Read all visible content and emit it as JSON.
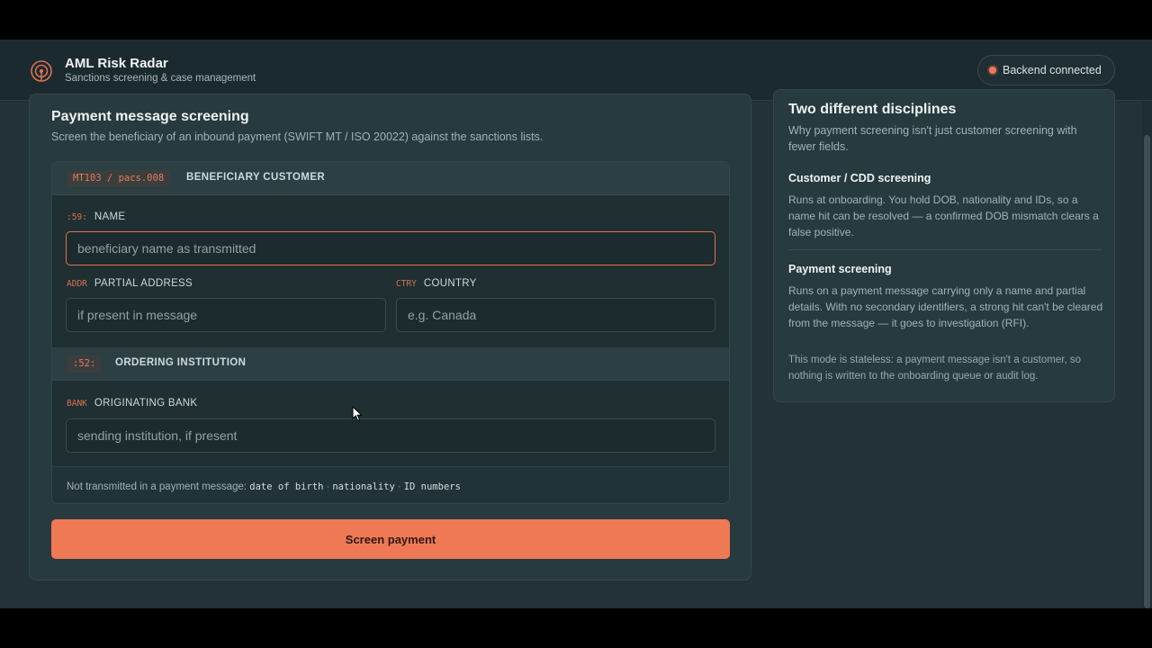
{
  "app": {
    "title": "AML Risk Radar",
    "subtitle": "Sanctions screening & case management",
    "logo_icon": "radar-icon",
    "status": {
      "text": "Backend connected",
      "color": "#f0795a"
    }
  },
  "screening": {
    "title": "Payment message screening",
    "description": "Screen the beneficiary of an inbound payment (SWIFT MT / ISO 20022) against the sanctions lists.",
    "beneficiary_block": {
      "tag": "MT103 / pacs.008",
      "title": "BENEFICIARY CUSTOMER",
      "name_field": {
        "code": ":59:",
        "label": "NAME",
        "value": "",
        "placeholder": "beneficiary name as transmitted"
      },
      "address_field": {
        "code": "ADDR",
        "label": "PARTIAL ADDRESS",
        "value": "",
        "placeholder": "if present in message"
      },
      "country_field": {
        "code": "CTRY",
        "label": "COUNTRY",
        "value": "",
        "placeholder": "e.g. Canada"
      }
    },
    "ordering_block": {
      "tag": ":52:",
      "title": "ORDERING INSTITUTION",
      "bank_field": {
        "code": "BANK",
        "label": "ORIGINATING BANK",
        "value": "",
        "placeholder": "sending institution, if present"
      }
    },
    "footer_note": {
      "prefix": "Not transmitted in a payment message:",
      "items": [
        "date of birth",
        "nationality",
        "ID numbers"
      ],
      "separator": "·"
    },
    "submit_label": "Screen payment"
  },
  "sidebar": {
    "title": "Two different disciplines",
    "intro": "Why payment screening isn't just customer screening with fewer fields.",
    "sections": [
      {
        "heading": "Customer / CDD screening",
        "body": "Runs at onboarding. You hold DOB, nationality and IDs, so a name hit can be resolved — a confirmed DOB mismatch clears a false positive."
      },
      {
        "heading": "Payment screening",
        "body": "Runs on a payment message carrying only a name and partial details. With no secondary identifiers, a strong hit can't be cleared from the message — it goes to investigation (RFI)."
      }
    ],
    "note": "This mode is stateless: a payment message isn't a customer, so nothing is written to the onboarding queue or audit log."
  },
  "colors": {
    "accent": "#ef7855",
    "background": "#223236",
    "card": "#273a3e"
  }
}
